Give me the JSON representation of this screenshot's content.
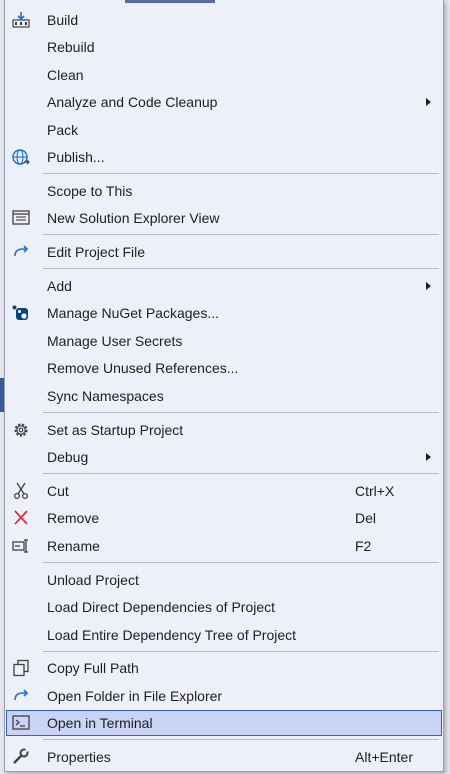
{
  "menu": {
    "items": [
      {
        "key": "build",
        "label": "Build",
        "icon": "build-icon"
      },
      {
        "key": "rebuild",
        "label": "Rebuild"
      },
      {
        "key": "clean",
        "label": "Clean"
      },
      {
        "key": "analyze",
        "label": "Analyze and Code Cleanup",
        "submenu": true
      },
      {
        "key": "pack",
        "label": "Pack"
      },
      {
        "key": "publish",
        "label": "Publish...",
        "icon": "globe-publish-icon"
      },
      {
        "key": "scope",
        "label": "Scope to This"
      },
      {
        "key": "new-view",
        "label": "New Solution Explorer View",
        "icon": "solution-explorer-icon"
      },
      {
        "key": "edit-project",
        "label": "Edit Project File",
        "icon": "redo-arrow-icon"
      },
      {
        "key": "add",
        "label": "Add",
        "submenu": true
      },
      {
        "key": "nuget",
        "label": "Manage NuGet Packages...",
        "icon": "nuget-icon"
      },
      {
        "key": "user-secrets",
        "label": "Manage User Secrets"
      },
      {
        "key": "remove-refs",
        "label": "Remove Unused References..."
      },
      {
        "key": "sync-ns",
        "label": "Sync Namespaces"
      },
      {
        "key": "startup",
        "label": "Set as Startup Project",
        "icon": "gear-icon"
      },
      {
        "key": "debug",
        "label": "Debug",
        "submenu": true
      },
      {
        "key": "cut",
        "label": "Cut",
        "shortcut": "Ctrl+X",
        "icon": "scissors-icon"
      },
      {
        "key": "remove",
        "label": "Remove",
        "shortcut": "Del",
        "icon": "close-icon"
      },
      {
        "key": "rename",
        "label": "Rename",
        "shortcut": "F2",
        "icon": "rename-icon"
      },
      {
        "key": "unload",
        "label": "Unload Project"
      },
      {
        "key": "load-direct",
        "label": "Load Direct Dependencies of Project"
      },
      {
        "key": "load-tree",
        "label": "Load Entire Dependency Tree of Project"
      },
      {
        "key": "copy-path",
        "label": "Copy Full Path",
        "icon": "copy-icon"
      },
      {
        "key": "open-folder",
        "label": "Open Folder in File Explorer",
        "icon": "redo-arrow-icon"
      },
      {
        "key": "open-terminal",
        "label": "Open in Terminal",
        "icon": "terminal-icon",
        "highlighted": true
      },
      {
        "key": "properties",
        "label": "Properties",
        "shortcut": "Alt+Enter",
        "icon": "wrench-icon"
      }
    ]
  },
  "colors": {
    "menu_background": "#eef0f9",
    "highlight_background": "#c9d3f3",
    "highlight_border": "#3b5fc0",
    "icon_blue": "#1c6fd1",
    "remove_red": "#d13438"
  }
}
